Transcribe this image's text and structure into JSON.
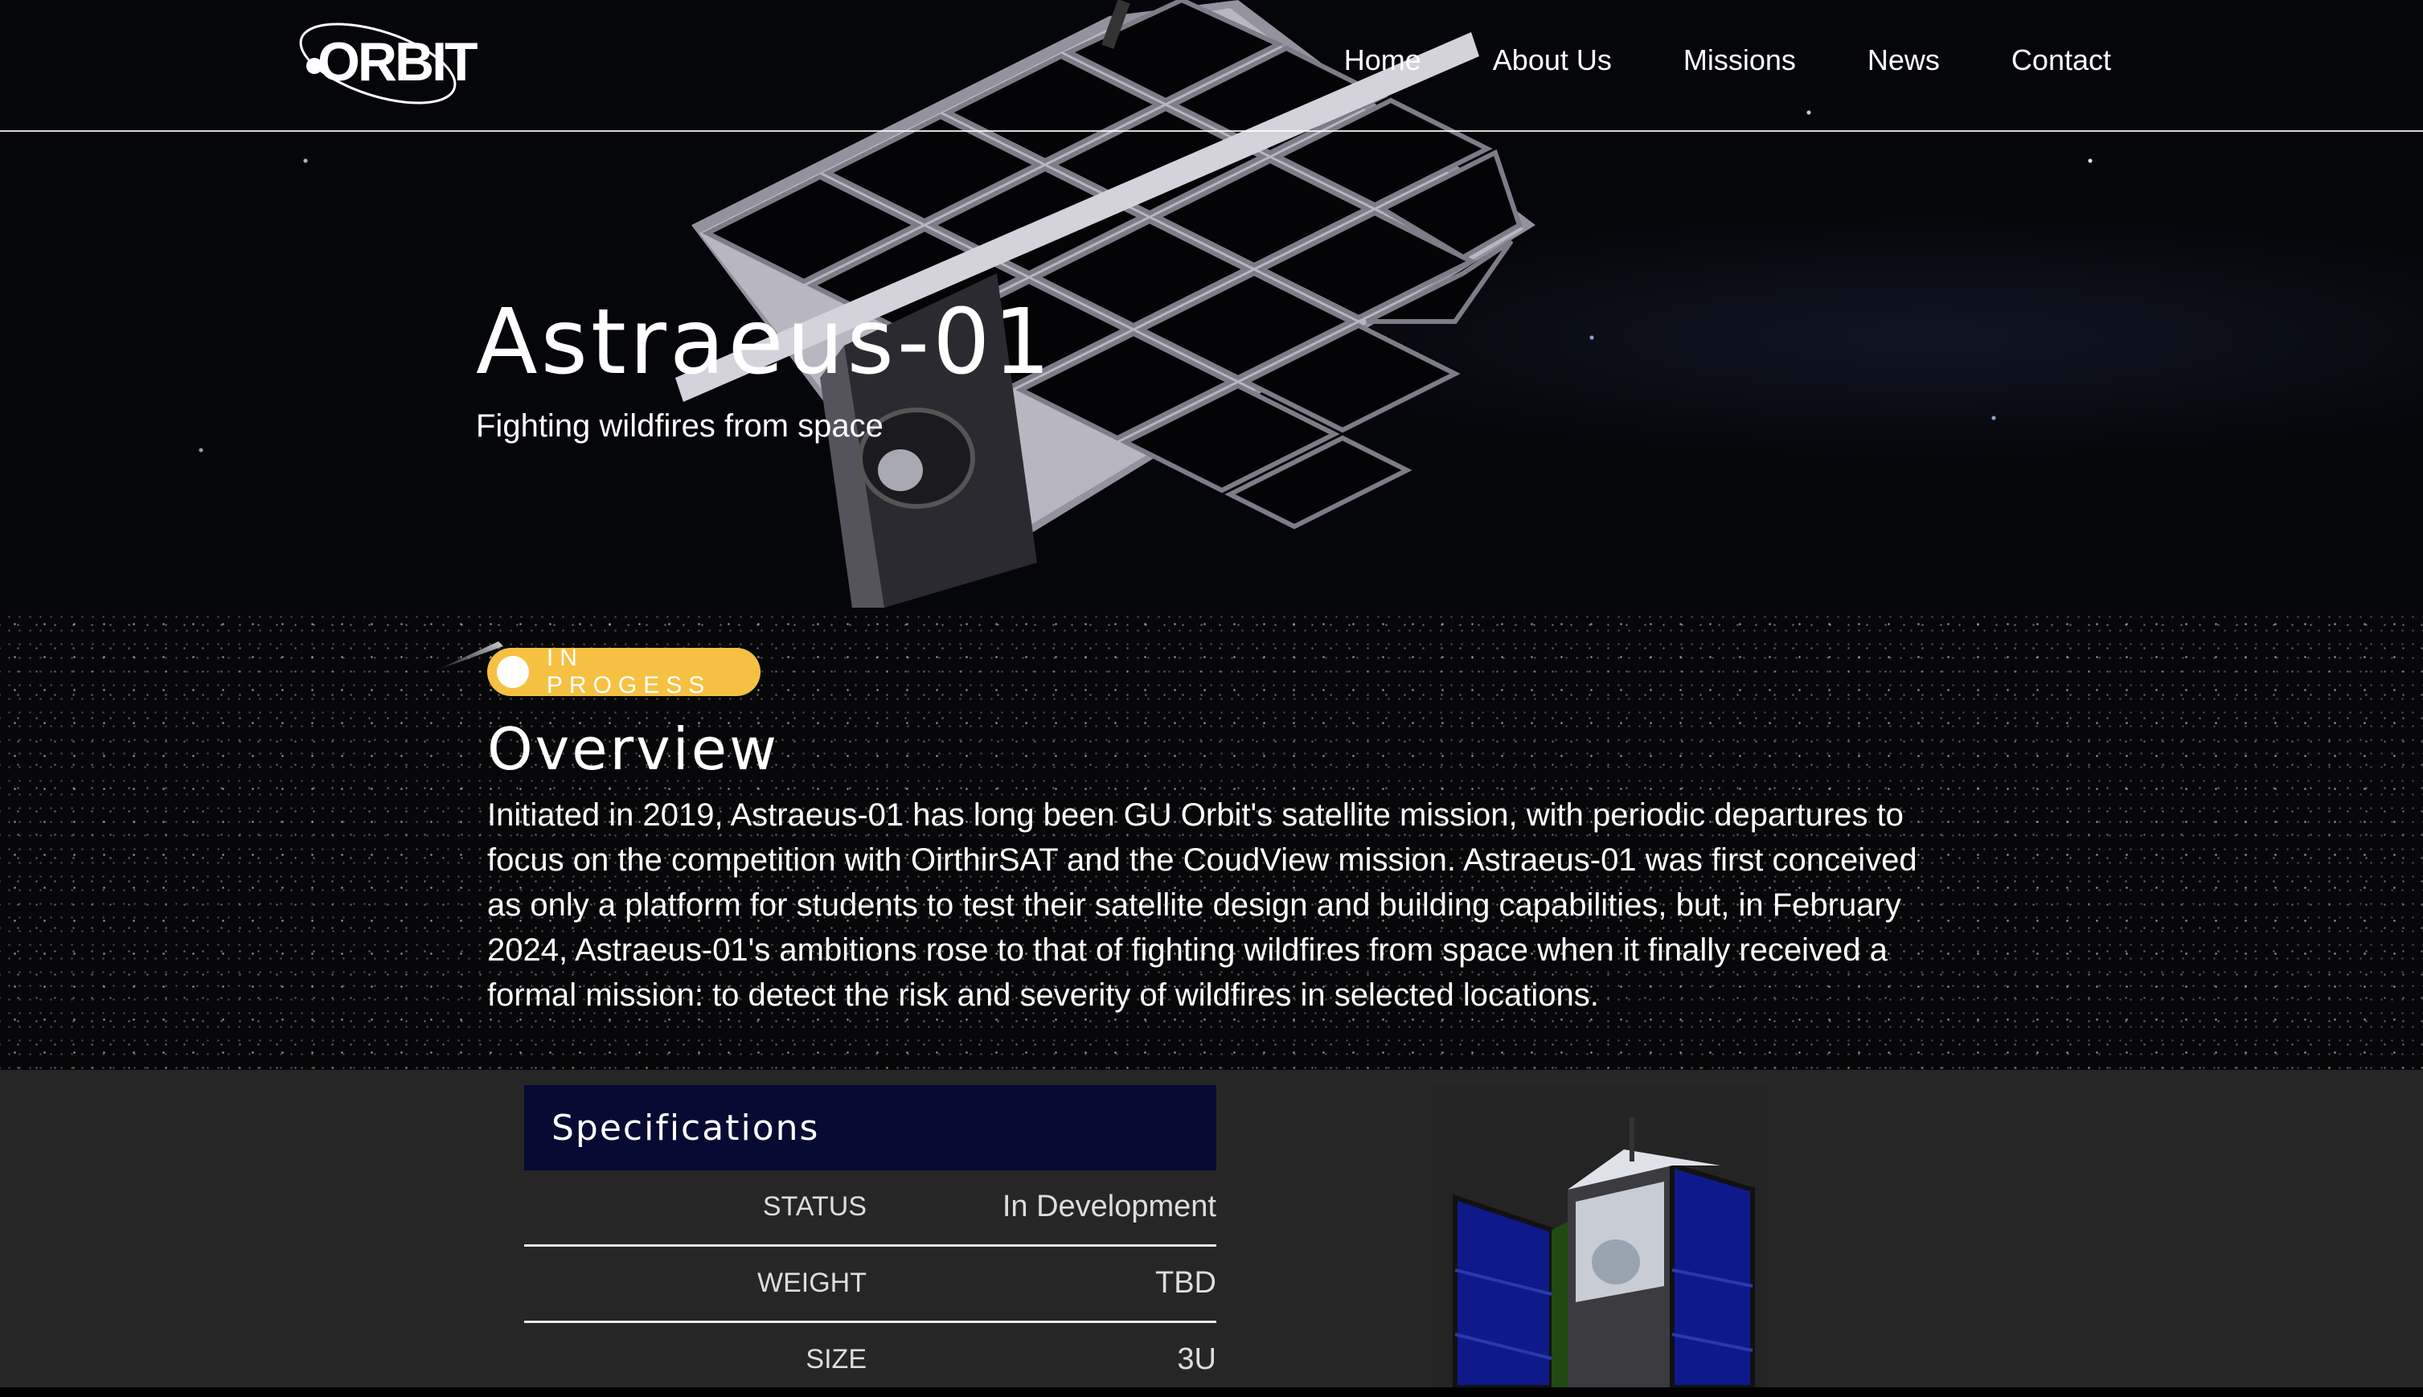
{
  "nav": {
    "logo_text": "ORBIT",
    "links": [
      "Home",
      "About Us",
      "Missions",
      "News",
      "Contact"
    ]
  },
  "hero": {
    "title": "Astraeus-01",
    "subtitle": "Fighting wildfires from space"
  },
  "status_badge": {
    "label": "IN PROGESS",
    "color": "#f6c142"
  },
  "overview": {
    "heading": "Overview",
    "body": "Initiated in 2019, Astraeus-01 has long been GU Orbit's satellite mission, with periodic departures to focus on the competition with OirthirSAT and the CoudView mission. Astraeus-01 was first conceived as only a platform for students to test their satellite design and building capabilities, but, in February 2024, Astraeus-01's ambitions rose to that of fighting wildfires from space when it finally received a formal mission: to detect the risk and severity of wildfires in selected locations."
  },
  "specifications": {
    "title": "Specifications",
    "rows": [
      {
        "key": "STATUS",
        "value": "In Development"
      },
      {
        "key": "WEIGHT",
        "value": "TBD"
      },
      {
        "key": "SIZE",
        "value": "3U"
      }
    ]
  },
  "colors": {
    "spec_header_bg": "#070a32",
    "specs_section_bg": "#262626"
  }
}
